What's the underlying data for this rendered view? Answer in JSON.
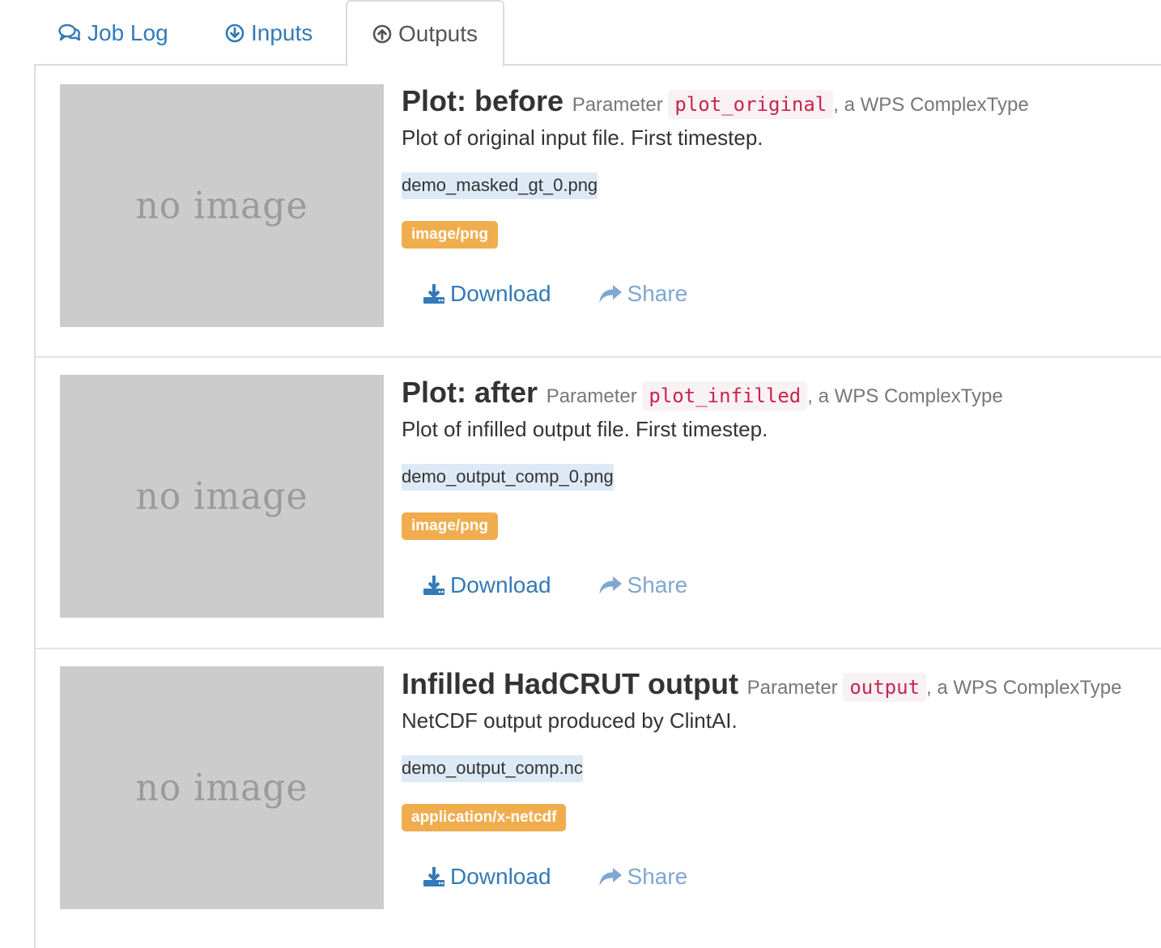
{
  "tabs": [
    {
      "label": "Job Log",
      "icon": "comments-icon"
    },
    {
      "label": "Inputs",
      "icon": "arrow-circle-down-icon"
    },
    {
      "label": "Outputs",
      "icon": "arrow-circle-up-icon"
    }
  ],
  "colors": {
    "link": "#337ab7",
    "share": "#7fa7d0",
    "badge": "#f0ad4e",
    "code_text": "#c7254e",
    "code_bg": "#f9f2f4",
    "filename_bg": "#ddeaf6",
    "thumb_bg": "#cccccc"
  },
  "outputs": [
    {
      "thumbnail_text": "no image",
      "title": "Plot: before",
      "param_prefix": "Parameter",
      "param_name": "plot_original",
      "param_suffix": ", a WPS ComplexType",
      "description": "Plot of original input file. First timestep.",
      "filename": "demo_masked_gt_0.png",
      "mime": "image/png",
      "download_label": "Download",
      "share_label": "Share"
    },
    {
      "thumbnail_text": "no image",
      "title": "Plot: after",
      "param_prefix": "Parameter",
      "param_name": "plot_infilled",
      "param_suffix": ", a WPS ComplexType",
      "description": "Plot of infilled output file. First timestep.",
      "filename": "demo_output_comp_0.png",
      "mime": "image/png",
      "download_label": "Download",
      "share_label": "Share"
    },
    {
      "thumbnail_text": "no image",
      "title": "Infilled HadCRUT output",
      "param_prefix": "Parameter",
      "param_name": "output",
      "param_suffix": ", a WPS ComplexType",
      "description": "NetCDF output produced by ClintAI.",
      "filename": "demo_output_comp.nc",
      "mime": "application/x-netcdf",
      "download_label": "Download",
      "share_label": "Share"
    }
  ]
}
